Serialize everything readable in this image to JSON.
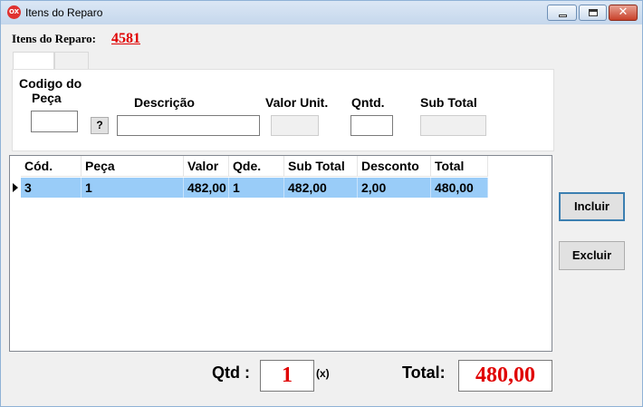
{
  "window": {
    "title": "Itens do Reparo",
    "icon_text": "OX",
    "close_glyph": "✕"
  },
  "header": {
    "label": "Itens do Reparo:",
    "number": "4581"
  },
  "form": {
    "codigo_label_line1": "Codigo do",
    "codigo_label_line2": "Peça",
    "lookup_button": "?",
    "descricao_label": "Descrição",
    "valor_unit_label": "Valor Unit.",
    "qntd_label": "Qntd.",
    "sub_total_label": "Sub Total",
    "codigo_value": "",
    "descricao_value": "",
    "valor_unit_value": "",
    "qntd_value": "",
    "sub_total_value": ""
  },
  "grid": {
    "columns": [
      "Cód.",
      "Peça",
      "Valor",
      "Qde.",
      "Sub Total",
      "Desconto",
      "Total"
    ],
    "rows": [
      [
        "3",
        "1",
        "482,00",
        "1",
        "482,00",
        "2,00",
        "480,00"
      ]
    ]
  },
  "buttons": {
    "incluir": "Incluir",
    "excluir": "Excluir"
  },
  "footer": {
    "qtd_label": "Qtd :",
    "qtd_value": "1",
    "multiplier": "(x)",
    "total_label": "Total:",
    "total_value": "480,00"
  },
  "colors": {
    "accent_red": "#e00000",
    "selection_blue": "#99ccf8"
  }
}
